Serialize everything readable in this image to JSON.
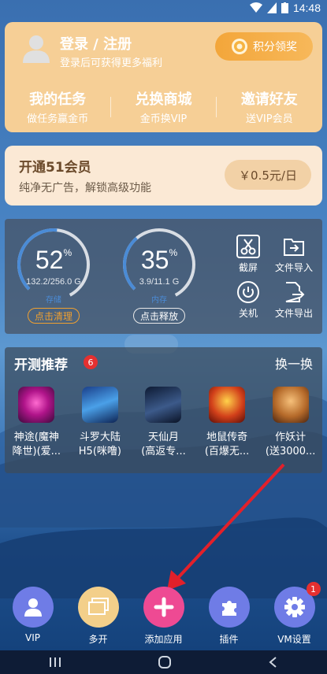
{
  "status_bar": {
    "time": "14:48"
  },
  "login_card": {
    "title": "登录 / 注册",
    "subtitle": "登录后可获得更多福利",
    "points_button": "积分领奖",
    "links": [
      {
        "title": "我的任务",
        "subtitle": "做任务赢金币"
      },
      {
        "title": "兑换商城",
        "subtitle": "金币换VIP"
      },
      {
        "title": "邀请好友",
        "subtitle": "送VIP会员"
      }
    ]
  },
  "vip_card": {
    "title": "开通51会员",
    "subtitle": "纯净无广告，解锁高级功能",
    "price": "￥0.5元/日"
  },
  "storage": {
    "storage_gauge": {
      "percent": "52",
      "unit": "%",
      "detail": "132.2/256.0 G",
      "type_label": "存储",
      "button": "点击清理",
      "fraction": 0.52
    },
    "ram_gauge": {
      "percent": "35",
      "unit": "%",
      "detail": "3.9/11.1 G",
      "type_label": "内存",
      "button": "点击释放",
      "fraction": 0.35
    },
    "tools": [
      {
        "label": "截屏",
        "icon": "scissors-icon"
      },
      {
        "label": "文件导入",
        "icon": "folder-import-icon"
      },
      {
        "label": "关机",
        "icon": "power-icon"
      },
      {
        "label": "文件导出",
        "icon": "file-export-icon"
      }
    ]
  },
  "recommend": {
    "title": "开测推荐",
    "badge": "6",
    "refresh": "换一换",
    "games": [
      {
        "line1": "神途(魔神",
        "line2": "降世)(爱..."
      },
      {
        "line1": "斗罗大陆",
        "line2": "H5(咪噜)"
      },
      {
        "line1": "天仙月",
        "line2": "(高返专..."
      },
      {
        "line1": "地鼠传奇",
        "line2": "(百爆无..."
      },
      {
        "line1": "作妖计",
        "line2": "(送3000..."
      }
    ]
  },
  "dock": {
    "items": [
      {
        "label": "VIP",
        "icon": "user-icon",
        "color": "#6f7ce6"
      },
      {
        "label": "多开",
        "icon": "multi-window-icon",
        "color": "#f3cf8a"
      },
      {
        "label": "添加应用",
        "icon": "plus-icon",
        "color": "#ee4a93"
      },
      {
        "label": "插件",
        "icon": "puzzle-icon",
        "color": "#6f7ce6"
      },
      {
        "label": "VM设置",
        "icon": "gear-icon",
        "color": "#6f7ce6",
        "badge": "1"
      }
    ]
  },
  "colors": {
    "accent_orange": "#f3a63a",
    "badge_red": "#e53030",
    "gauge_blue": "#4a8bd6",
    "arrow_red": "#e3202a"
  }
}
